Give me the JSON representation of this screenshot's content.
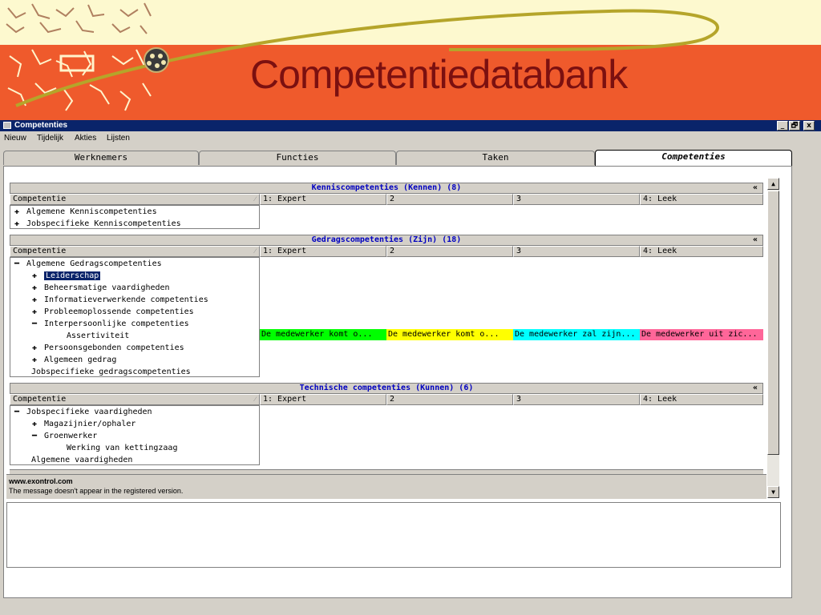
{
  "slide": {
    "title": "Competentiedatabank"
  },
  "window": {
    "title": "Competenties",
    "controls": {
      "minimize": "_",
      "restore": "🗗",
      "close": "x"
    }
  },
  "menu": [
    "Nieuw",
    "Tijdelijk",
    "Akties",
    "Lijsten"
  ],
  "tabs": [
    {
      "label": "Werknemers",
      "active": false
    },
    {
      "label": "Functies",
      "active": false
    },
    {
      "label": "Taken",
      "active": false
    },
    {
      "label": "Competenties",
      "active": true
    }
  ],
  "columns": [
    "Competentie",
    "1: Expert",
    "2",
    "3",
    "4: Leek"
  ],
  "sections": [
    {
      "title": "Kenniscompetenties (Kennen) (8)",
      "nodes": [
        {
          "label": "Algemene Kenniscompetenties",
          "expander": "+"
        },
        {
          "label": "Jobspecifieke Kenniscompetenties",
          "expander": "+"
        }
      ]
    },
    {
      "title": "Gedragscompetenties (Zijn) (18)",
      "nodes": [
        {
          "label": "Algemene Gedragscompetenties",
          "expander": "-"
        },
        {
          "label": "Leiderschap",
          "expander": "+"
        },
        {
          "label": "Beheersmatige vaardigheden",
          "expander": "+"
        },
        {
          "label": "Informatieverwerkende competenties",
          "expander": "+"
        },
        {
          "label": "Probleemoplossende competenties",
          "expander": "+"
        },
        {
          "label": "Interpersoonlijke competenties",
          "expander": "-"
        },
        {
          "label": "Assertiviteit",
          "expander": ""
        },
        {
          "label": "Persoonsgebonden competenties",
          "expander": "+"
        },
        {
          "label": "Algemeen gedrag",
          "expander": "+"
        },
        {
          "label": "Jobspecifieke gedragscompetenties",
          "expander": ""
        }
      ],
      "assertiviteit_cells": [
        {
          "text": "De medewerker komt o...",
          "color": "#00ff00"
        },
        {
          "text": "De medewerker komt o...",
          "color": "#ffff00"
        },
        {
          "text": "De medewerker zal zijn...",
          "color": "#00ffff"
        },
        {
          "text": "De medewerker uit zic...",
          "color": "#ff6699"
        }
      ]
    },
    {
      "title": "Technische competenties (Kunnen) (6)",
      "nodes": [
        {
          "label": "Jobspecifieke vaardigheden",
          "expander": "-"
        },
        {
          "label": "Magazijnier/ophaler",
          "expander": "+"
        },
        {
          "label": "Groenwerker",
          "expander": "-"
        },
        {
          "label": "Werking van kettingzaag",
          "expander": ""
        },
        {
          "label": "Algemene vaardigheden",
          "expander": ""
        }
      ]
    }
  ],
  "infobar": {
    "site": "www.exontrol.com",
    "message": "The message doesn't appear in the registered version."
  },
  "icons": {
    "expand": "✚",
    "collapse": "━",
    "sort": "⁄",
    "collapse_section": "«",
    "scroll_up": "▲",
    "scroll_down": "▼"
  }
}
